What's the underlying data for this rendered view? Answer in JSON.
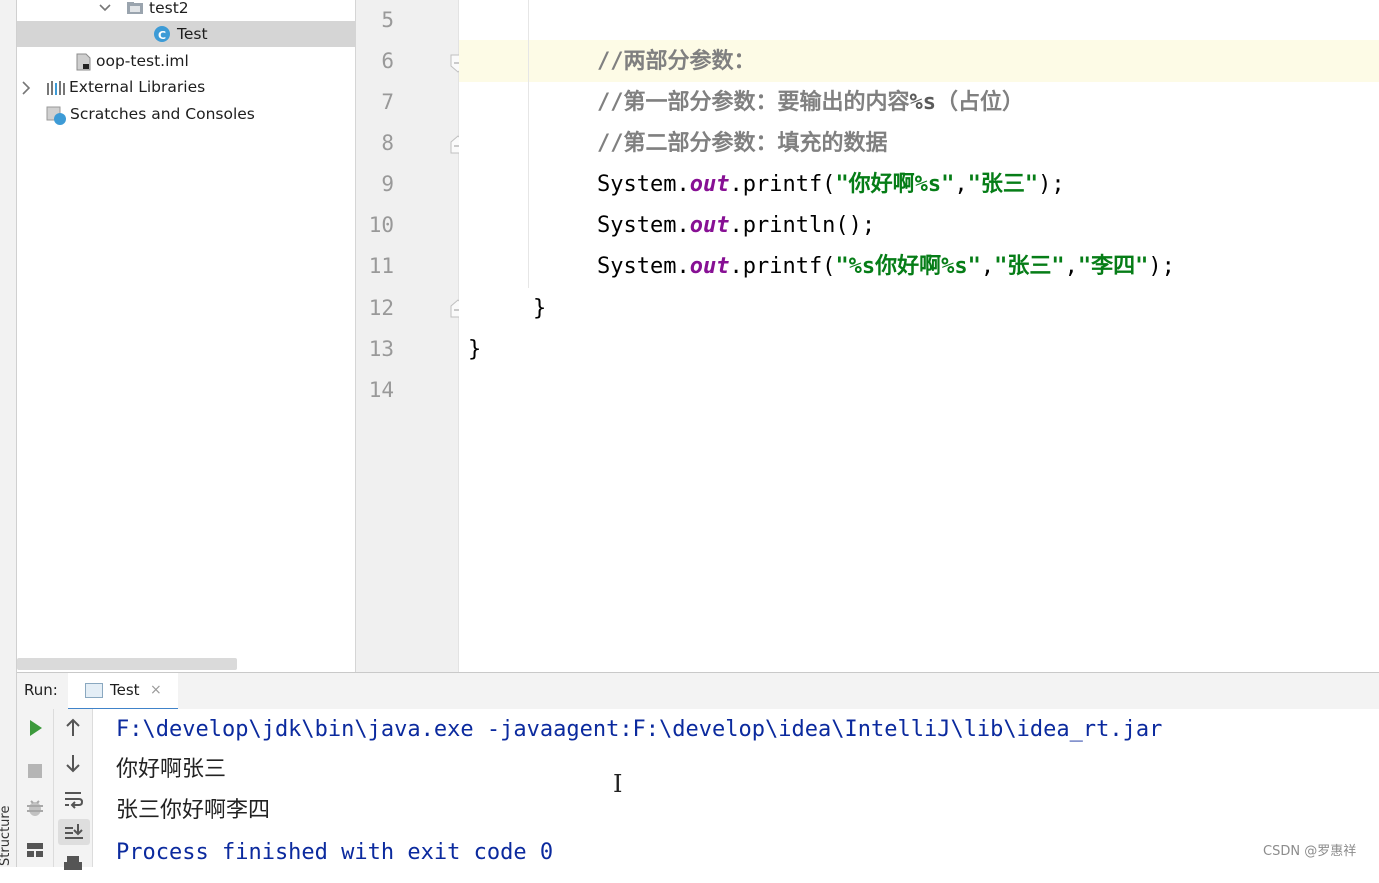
{
  "project_tree": {
    "folder_test2": "test2",
    "class_test": "Test",
    "file_iml": "oop-test.iml",
    "external_libraries": "External Libraries",
    "scratches": "Scratches and Consoles"
  },
  "side_tab": "Structure",
  "editor": {
    "line_numbers": [
      "5",
      "6",
      "7",
      "8",
      "9",
      "10",
      "11",
      "12",
      "13",
      "14"
    ],
    "comment1": "//两部分参数：",
    "comment2_a": "//第一部分参数：要输出的内容",
    "comment2_b": "%s",
    "comment2_c": "（占位）",
    "comment3": "//第二部分参数：填充的数据",
    "line9": {
      "prefix": "System.",
      "field": "out",
      "mid": ".printf(",
      "s1": "\"你好啊%s\"",
      "comma": ",",
      "s2": "\"张三\"",
      "end": ");"
    },
    "line10": {
      "prefix": "System.",
      "field": "out",
      "end": ".println();"
    },
    "line11": {
      "prefix": "System.",
      "field": "out",
      "mid": ".printf(",
      "s1": "\"%s你好啊%s\"",
      "comma1": ",",
      "s2": "\"张三\"",
      "comma2": ",",
      "s3": "\"李四\"",
      "end": ");"
    },
    "brace_inner": "}",
    "brace_outer": "}"
  },
  "run_panel": {
    "label": "Run:",
    "tab_label": "Test",
    "tab_close": "×",
    "console_lines": [
      "F:\\develop\\jdk\\bin\\java.exe -javaagent:F:\\develop\\idea\\IntelliJ\\lib\\idea_rt.jar",
      "你好啊张三",
      "张三你好啊李四",
      "Process finished with exit code 0"
    ]
  },
  "watermark": "CSDN @罗惠祥",
  "colors": {
    "comment": "#808080",
    "string": "#067d17",
    "field": "#871094",
    "console_command": "#0b2a9e",
    "console_finished": "#0b2a9e",
    "run_green": "#3c9a3c",
    "tab_underline": "#4083c9"
  },
  "icons": [
    "chevron-down-icon",
    "folder-icon",
    "java-class-icon",
    "iml-file-icon",
    "chevron-right-icon",
    "library-icon",
    "scratches-icon",
    "run-icon",
    "stop-icon",
    "bug-icon",
    "up-arrow-icon",
    "down-arrow-icon",
    "soft-wrap-icon",
    "scroll-to-end-icon",
    "layout-icon",
    "print-icon"
  ]
}
